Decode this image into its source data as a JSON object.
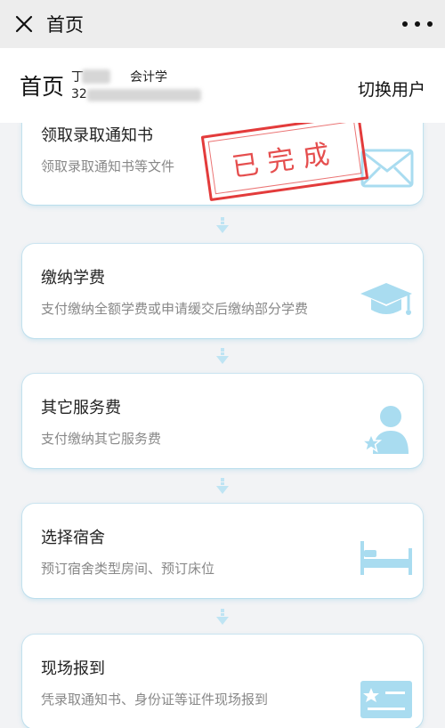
{
  "nav": {
    "title": "首页"
  },
  "header": {
    "page_title": "首页",
    "user_name": "丁",
    "user_major": "会计学",
    "user_id": "32",
    "switch_user_label": "切换用户"
  },
  "stamp": {
    "text": "已完成"
  },
  "cards": [
    {
      "title": "领取录取通知书",
      "desc": "领取录取通知书等文件",
      "icon": "envelope-icon"
    },
    {
      "title": "缴纳学费",
      "desc": "支付缴纳全额学费或申请缓交后缴纳部分学费",
      "icon": "graduation-cap-icon"
    },
    {
      "title": "其它服务费",
      "desc": "支付缴纳其它服务费",
      "icon": "user-star-icon"
    },
    {
      "title": "选择宿舍",
      "desc": "预订宿舍类型房间、预订床位",
      "icon": "bed-icon"
    },
    {
      "title": "现场报到",
      "desc": "凭录取通知书、身份证等证件现场报到",
      "icon": "id-card-icon"
    }
  ],
  "colors": {
    "accent": "#8fd3ec",
    "stamp": "#e33b3b"
  }
}
